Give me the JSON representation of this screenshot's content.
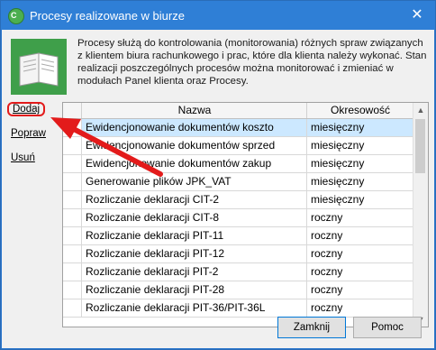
{
  "window": {
    "title": "Procesy realizowane w biurze",
    "close_glyph": "✕",
    "app_icon_letter": "C"
  },
  "description": "Procesy służą do kontrolowania (monitorowania) różnych spraw związanych z klientem biura rachunkowego i prac, które dla klienta należy wykonać. Stan realizacji poszczególnych procesów można monitorować i zmieniać w modułach Panel klienta oraz Procesy.",
  "actions": {
    "add": "Dodaj",
    "edit": "Popraw",
    "delete": "Usuń"
  },
  "table": {
    "columns": [
      "Nazwa",
      "Okresowość"
    ],
    "rows": [
      {
        "name": "Ewidencjonowanie dokumentów koszto",
        "period": "miesięczny",
        "selected": true
      },
      {
        "name": "Ewidencjonowanie dokumentów sprzed",
        "period": "miesięczny"
      },
      {
        "name": "Ewidencjonowanie dokumentów zakup",
        "period": "miesięczny"
      },
      {
        "name": "Generowanie plików JPK_VAT",
        "period": "miesięczny"
      },
      {
        "name": "Rozliczanie deklaracji CIT-2",
        "period": "miesięczny"
      },
      {
        "name": "Rozliczanie deklaracji CIT-8",
        "period": "roczny"
      },
      {
        "name": "Rozliczanie deklaracji PIT-11",
        "period": "roczny"
      },
      {
        "name": "Rozliczanie deklaracji PIT-12",
        "period": "roczny"
      },
      {
        "name": "Rozliczanie deklaracji PIT-2",
        "period": "roczny"
      },
      {
        "name": "Rozliczanie deklaracji PIT-28",
        "period": "roczny"
      },
      {
        "name": "Rozliczanie deklaracji PIT-36/PIT-36L",
        "period": "roczny"
      }
    ]
  },
  "buttons": {
    "close": "Zamknij",
    "help": "Pomoc"
  },
  "colors": {
    "titlebar": "#2f7fd6",
    "selection": "#cce8ff",
    "highlight": "#e31b1b"
  }
}
